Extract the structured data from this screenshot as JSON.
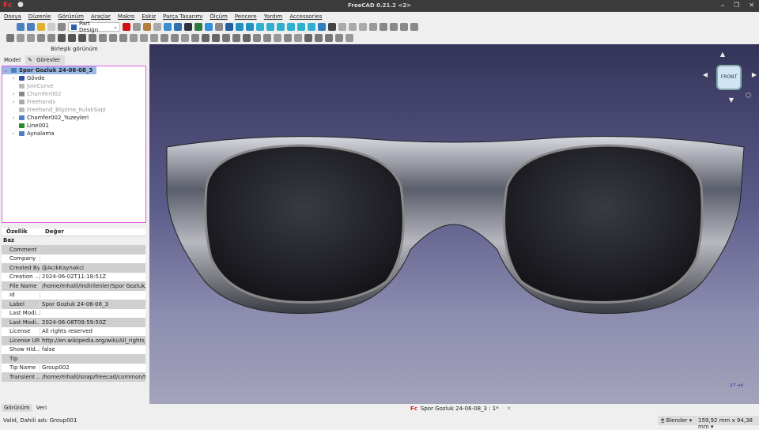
{
  "window": {
    "title": "FreeCAD 0.21.2 <2>",
    "logo": "Fc"
  },
  "menu": [
    "Dosya",
    "Düzenle",
    "Görünüm",
    "Araçlar",
    "Makro",
    "Eskiz",
    "Parça Tasarımı",
    "Ölçüm",
    "Pencere",
    "Yardım",
    "Accessories"
  ],
  "toolbar": {
    "workbench": "Part Design",
    "row1": [
      "#eee",
      "#4a7fc0",
      "#4a7fc0",
      "#e0b030",
      "#ccc",
      "#888",
      "#d01010",
      "#999",
      "#b08040",
      "#aaa",
      "#3a8fd0",
      "#3070b0",
      "#303040",
      "#2a7a40",
      "#3090e0",
      "#888",
      "#2060a0",
      "#2090c0",
      "#2090c0",
      "#30b0d0",
      "#30b0d0",
      "#30b0d0",
      "#30b0d0",
      "#30b0d0",
      "#30b0d0",
      "#3080c0",
      "#444",
      "#aaa",
      "#aaa",
      "#aaa",
      "#999",
      "#888",
      "#888",
      "#888",
      "#888"
    ],
    "row2": [
      "#777",
      "#999",
      "#999",
      "#888",
      "#888",
      "#555",
      "#555",
      "#555",
      "#777",
      "#888",
      "#888",
      "#888",
      "#999",
      "#999",
      "#999",
      "#888",
      "#888",
      "#999",
      "#888",
      "#666",
      "#666",
      "#777",
      "#777",
      "#666",
      "#888",
      "#888",
      "#999",
      "#888",
      "#999",
      "#666",
      "#777",
      "#777",
      "#888",
      "#999"
    ]
  },
  "combo": {
    "title": "Birleşik görünüm",
    "tabs": [
      "Model",
      "Görevler"
    ]
  },
  "tree": [
    {
      "label": "Spor Gozluk 24-06-08_3",
      "level": 0,
      "color": "#4a7fc0",
      "selected": true,
      "icon": "document-icon"
    },
    {
      "label": "Gövde",
      "level": 1,
      "color": "#3050a0",
      "icon": "body-icon",
      "exp": true
    },
    {
      "label": "JoinCurve",
      "level": 1,
      "color": "#bbb",
      "grey": true,
      "icon": "curve-icon"
    },
    {
      "label": "Chamfer002",
      "level": 1,
      "color": "#888",
      "grey": true,
      "icon": "chamfer-icon",
      "exp": true
    },
    {
      "label": "Freehands",
      "level": 1,
      "color": "#aaa",
      "grey": true,
      "icon": "folder-icon",
      "exp": true
    },
    {
      "label": "Freehand_BSpline_KulakSapi",
      "level": 1,
      "color": "#bbb",
      "grey": true,
      "icon": "bspline-icon"
    },
    {
      "label": "Chamfer002_Yuzeyleri",
      "level": 1,
      "color": "#4a7fc0",
      "icon": "folder-icon",
      "exp": true
    },
    {
      "label": "Line001",
      "level": 1,
      "color": "#2a8a2a",
      "icon": "line-icon"
    },
    {
      "label": "Aynalama",
      "level": 1,
      "color": "#4a7fc0",
      "icon": "folder-icon",
      "exp": true
    }
  ],
  "props": {
    "headers": [
      "Özellik",
      "Değer"
    ],
    "group": "Baz",
    "rows": [
      [
        "Comment",
        ""
      ],
      [
        "Company",
        ""
      ],
      [
        "Created By",
        "@AcikKaynakci"
      ],
      [
        "Creation ...",
        "2024-06-02T11:18:51Z"
      ],
      [
        "File Name",
        "/home/mhalil/İndirilenler/Spor Gozluk/S..."
      ],
      [
        "Id",
        ""
      ],
      [
        "Label",
        "Spor Gozluk 24-06-08_3"
      ],
      [
        "Last Modi...",
        ""
      ],
      [
        "Last Modi...",
        "2024-06-08T09:59:50Z"
      ],
      [
        "License",
        "All rights reserved"
      ],
      [
        "License URL",
        "http://en.wikipedia.org/wiki/All_rights_re..."
      ],
      [
        "Show Hid...",
        "false"
      ],
      [
        "Tip",
        ""
      ],
      [
        "Tip Name",
        "Group002"
      ],
      [
        "Transient ...",
        "/home/mhalil/snap/freecad/common/te..."
      ]
    ]
  },
  "bottom_tabs": [
    "Görünüm",
    "Veri"
  ],
  "navcube": {
    "face": "FRONT"
  },
  "doc_tab": "Spor Gozluk 24-06-08_3 : 1*",
  "status": {
    "text": "Valid, Dahili adı: Group001",
    "nav": "Blender",
    "dims": "159,92 mm x 94,38 mm"
  }
}
